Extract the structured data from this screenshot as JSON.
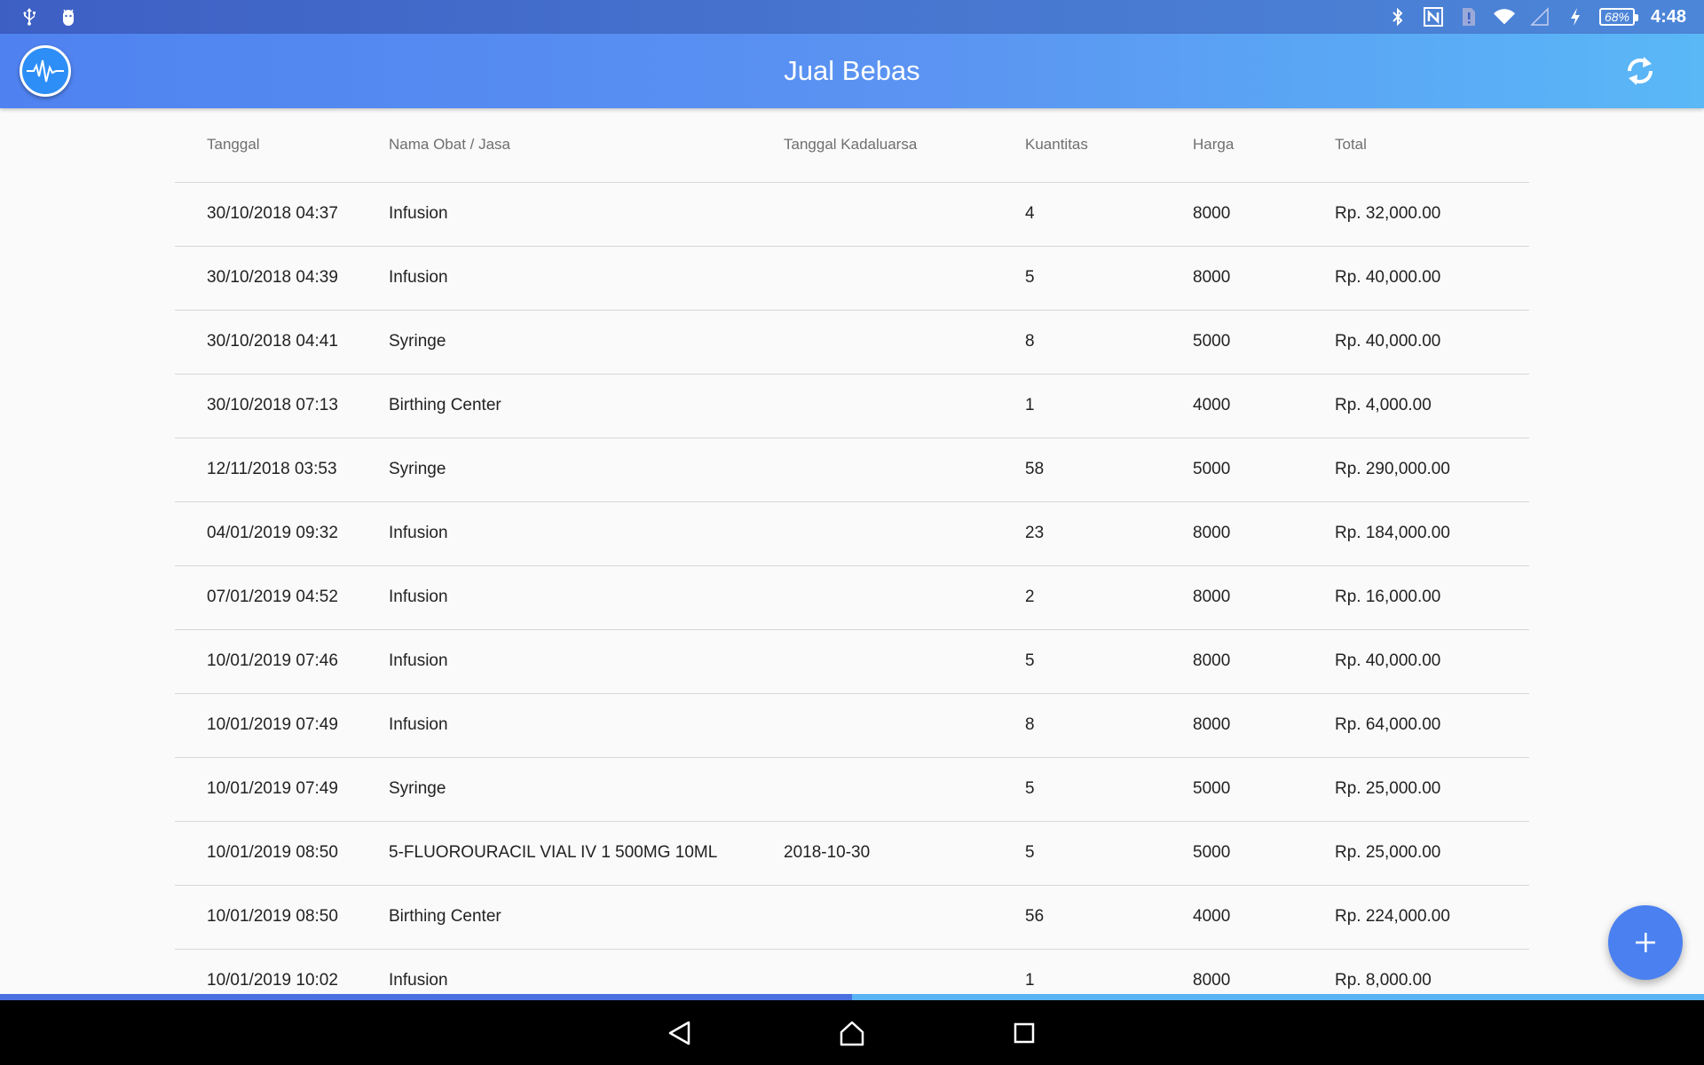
{
  "status_bar": {
    "time": "4:48",
    "battery": "68%",
    "icons_left": [
      "usb-icon",
      "android-debug-icon"
    ],
    "icons_right": [
      "bluetooth-icon",
      "nfc-icon",
      "sim-alert-icon",
      "wifi-icon",
      "cell-signal-icon",
      "charging-icon",
      "battery-icon"
    ]
  },
  "app_bar": {
    "title": "Jual Bebas",
    "logo_icon": "heartbeat-icon",
    "action_icon": "refresh-icon"
  },
  "table": {
    "headers": [
      "Tanggal",
      "Nama Obat / Jasa",
      "Tanggal Kadaluarsa",
      "Kuantitas",
      "Harga",
      "Total"
    ],
    "rows": [
      {
        "date": "30/10/2018 04:37",
        "name": "Infusion",
        "expiry": "",
        "qty": "4",
        "price": "8000",
        "total": "Rp. 32,000.00"
      },
      {
        "date": "30/10/2018 04:39",
        "name": "Infusion",
        "expiry": "",
        "qty": "5",
        "price": "8000",
        "total": "Rp. 40,000.00"
      },
      {
        "date": "30/10/2018 04:41",
        "name": "Syringe",
        "expiry": "",
        "qty": "8",
        "price": "5000",
        "total": "Rp. 40,000.00"
      },
      {
        "date": "30/10/2018 07:13",
        "name": "Birthing Center",
        "expiry": "",
        "qty": "1",
        "price": "4000",
        "total": "Rp. 4,000.00"
      },
      {
        "date": "12/11/2018 03:53",
        "name": "Syringe",
        "expiry": "",
        "qty": "58",
        "price": "5000",
        "total": "Rp. 290,000.00"
      },
      {
        "date": "04/01/2019 09:32",
        "name": "Infusion",
        "expiry": "",
        "qty": "23",
        "price": "8000",
        "total": "Rp. 184,000.00"
      },
      {
        "date": "07/01/2019 04:52",
        "name": "Infusion",
        "expiry": "",
        "qty": "2",
        "price": "8000",
        "total": "Rp. 16,000.00"
      },
      {
        "date": "10/01/2019 07:46",
        "name": "Infusion",
        "expiry": "",
        "qty": "5",
        "price": "8000",
        "total": "Rp. 40,000.00"
      },
      {
        "date": "10/01/2019 07:49",
        "name": "Infusion",
        "expiry": "",
        "qty": "8",
        "price": "8000",
        "total": "Rp. 64,000.00"
      },
      {
        "date": "10/01/2019 07:49",
        "name": "Syringe",
        "expiry": "",
        "qty": "5",
        "price": "5000",
        "total": "Rp. 25,000.00"
      },
      {
        "date": "10/01/2019 08:50",
        "name": "5-FLUOROURACIL VIAL IV 1 500MG 10ML",
        "expiry": "2018-10-30",
        "qty": "5",
        "price": "5000",
        "total": "Rp. 25,000.00"
      },
      {
        "date": "10/01/2019 08:50",
        "name": "Birthing Center",
        "expiry": "",
        "qty": "56",
        "price": "4000",
        "total": "Rp. 224,000.00"
      },
      {
        "date": "10/01/2019 10:02",
        "name": "Infusion",
        "expiry": "",
        "qty": "1",
        "price": "8000",
        "total": "Rp. 8,000.00"
      }
    ]
  },
  "fab": {
    "icon": "plus-icon"
  },
  "progress": {
    "fraction": 0.5
  },
  "colors": {
    "app_bar_start": "#4f82f0",
    "app_bar_end": "#5ab8f7",
    "fab": "#4a80f0",
    "status_bar": "#3d5fc4"
  },
  "nav_bar": {
    "icons": [
      "back-icon",
      "home-icon",
      "recents-icon"
    ]
  }
}
